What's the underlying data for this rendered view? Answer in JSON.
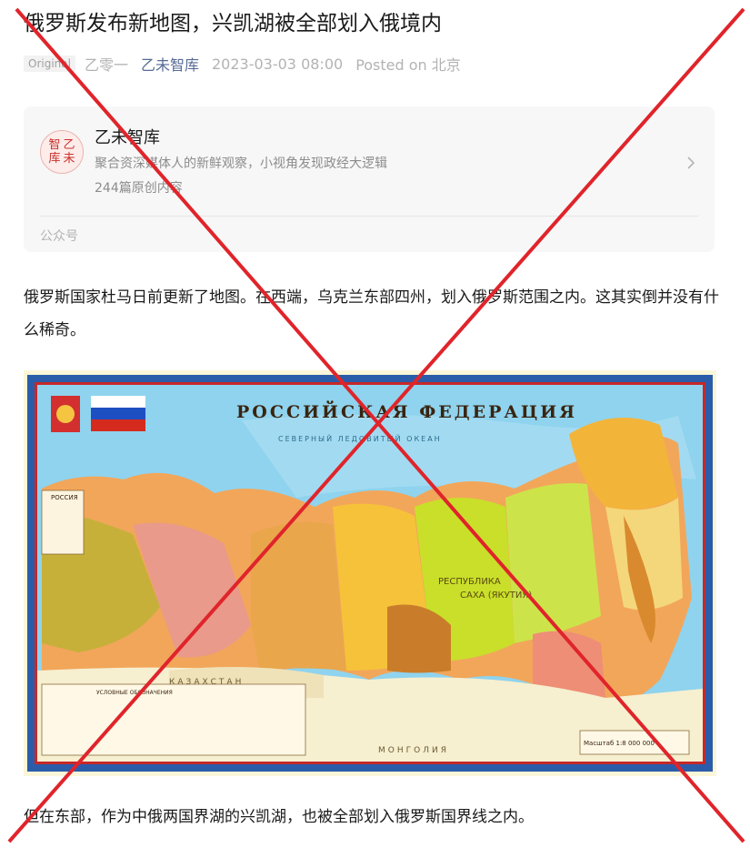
{
  "article": {
    "title": "俄罗斯发布新地图，兴凯湖被全部划入俄境内",
    "badge": "Original",
    "author": "乙零一",
    "account": "乙未智库",
    "date": "2023-03-03 08:00",
    "location": "Posted on 北京"
  },
  "profile_card": {
    "logo_chars": [
      "智",
      "乙",
      "库",
      "未"
    ],
    "name": "乙未智库",
    "description": "聚合资深媒体人的新鲜观察，小视角发现政经大逻辑",
    "count": "244篇原创内容",
    "footer": "公众号"
  },
  "paragraphs": [
    "俄罗斯国家杜马日前更新了地图。在西端，乌克兰东部四州，划入俄罗斯范围之内。这其实倒并没有什么稀奇。",
    "但在东部，作为中俄两国界湖的兴凯湖，也被全部划入俄罗斯国界线之内。"
  ],
  "map": {
    "heading": "РОССИЙСКАЯ ФЕДЕРАЦИЯ",
    "sea_label": "СЕВЕРНЫЙ ЛЕДОВИТЫЙ ОКЕАН",
    "region_label": "САХА (ЯКУТИЯ)",
    "region_label2": "РЕСПУБЛИКА",
    "country_label": "КАЗАХСТАН",
    "country_label2": "МОНГОЛИЯ",
    "scale": "Масштаб 1:8 000 000",
    "legend_title": "УСЛОВНЫЕ ОБОЗНАЧЕНИЯ",
    "inset_title": "РОССИЯ"
  },
  "colors": {
    "accent_link": "#576b95",
    "cross": "#e0242b",
    "ocean": "#8fd3ee",
    "frame": "#2a5caa"
  }
}
